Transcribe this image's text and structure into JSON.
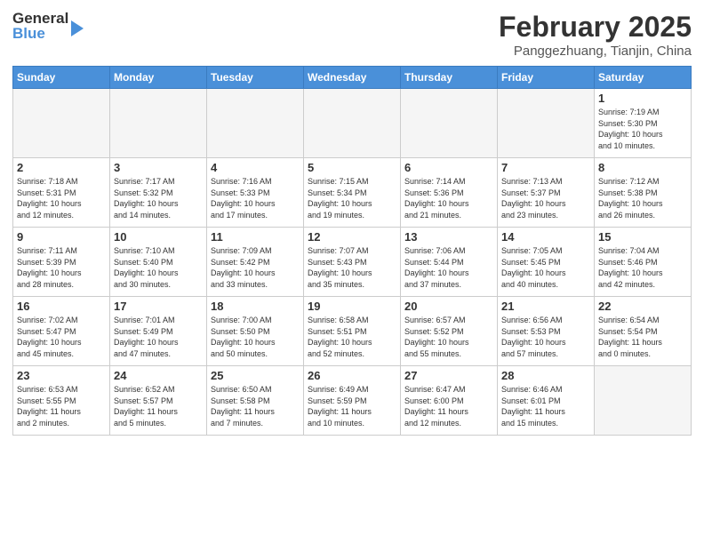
{
  "header": {
    "logo_general": "General",
    "logo_blue": "Blue",
    "month": "February 2025",
    "location": "Panggezhuang, Tianjin, China"
  },
  "weekdays": [
    "Sunday",
    "Monday",
    "Tuesday",
    "Wednesday",
    "Thursday",
    "Friday",
    "Saturday"
  ],
  "weeks": [
    [
      {
        "day": "",
        "info": ""
      },
      {
        "day": "",
        "info": ""
      },
      {
        "day": "",
        "info": ""
      },
      {
        "day": "",
        "info": ""
      },
      {
        "day": "",
        "info": ""
      },
      {
        "day": "",
        "info": ""
      },
      {
        "day": "1",
        "info": "Sunrise: 7:19 AM\nSunset: 5:30 PM\nDaylight: 10 hours\nand 10 minutes."
      }
    ],
    [
      {
        "day": "2",
        "info": "Sunrise: 7:18 AM\nSunset: 5:31 PM\nDaylight: 10 hours\nand 12 minutes."
      },
      {
        "day": "3",
        "info": "Sunrise: 7:17 AM\nSunset: 5:32 PM\nDaylight: 10 hours\nand 14 minutes."
      },
      {
        "day": "4",
        "info": "Sunrise: 7:16 AM\nSunset: 5:33 PM\nDaylight: 10 hours\nand 17 minutes."
      },
      {
        "day": "5",
        "info": "Sunrise: 7:15 AM\nSunset: 5:34 PM\nDaylight: 10 hours\nand 19 minutes."
      },
      {
        "day": "6",
        "info": "Sunrise: 7:14 AM\nSunset: 5:36 PM\nDaylight: 10 hours\nand 21 minutes."
      },
      {
        "day": "7",
        "info": "Sunrise: 7:13 AM\nSunset: 5:37 PM\nDaylight: 10 hours\nand 23 minutes."
      },
      {
        "day": "8",
        "info": "Sunrise: 7:12 AM\nSunset: 5:38 PM\nDaylight: 10 hours\nand 26 minutes."
      }
    ],
    [
      {
        "day": "9",
        "info": "Sunrise: 7:11 AM\nSunset: 5:39 PM\nDaylight: 10 hours\nand 28 minutes."
      },
      {
        "day": "10",
        "info": "Sunrise: 7:10 AM\nSunset: 5:40 PM\nDaylight: 10 hours\nand 30 minutes."
      },
      {
        "day": "11",
        "info": "Sunrise: 7:09 AM\nSunset: 5:42 PM\nDaylight: 10 hours\nand 33 minutes."
      },
      {
        "day": "12",
        "info": "Sunrise: 7:07 AM\nSunset: 5:43 PM\nDaylight: 10 hours\nand 35 minutes."
      },
      {
        "day": "13",
        "info": "Sunrise: 7:06 AM\nSunset: 5:44 PM\nDaylight: 10 hours\nand 37 minutes."
      },
      {
        "day": "14",
        "info": "Sunrise: 7:05 AM\nSunset: 5:45 PM\nDaylight: 10 hours\nand 40 minutes."
      },
      {
        "day": "15",
        "info": "Sunrise: 7:04 AM\nSunset: 5:46 PM\nDaylight: 10 hours\nand 42 minutes."
      }
    ],
    [
      {
        "day": "16",
        "info": "Sunrise: 7:02 AM\nSunset: 5:47 PM\nDaylight: 10 hours\nand 45 minutes."
      },
      {
        "day": "17",
        "info": "Sunrise: 7:01 AM\nSunset: 5:49 PM\nDaylight: 10 hours\nand 47 minutes."
      },
      {
        "day": "18",
        "info": "Sunrise: 7:00 AM\nSunset: 5:50 PM\nDaylight: 10 hours\nand 50 minutes."
      },
      {
        "day": "19",
        "info": "Sunrise: 6:58 AM\nSunset: 5:51 PM\nDaylight: 10 hours\nand 52 minutes."
      },
      {
        "day": "20",
        "info": "Sunrise: 6:57 AM\nSunset: 5:52 PM\nDaylight: 10 hours\nand 55 minutes."
      },
      {
        "day": "21",
        "info": "Sunrise: 6:56 AM\nSunset: 5:53 PM\nDaylight: 10 hours\nand 57 minutes."
      },
      {
        "day": "22",
        "info": "Sunrise: 6:54 AM\nSunset: 5:54 PM\nDaylight: 11 hours\nand 0 minutes."
      }
    ],
    [
      {
        "day": "23",
        "info": "Sunrise: 6:53 AM\nSunset: 5:55 PM\nDaylight: 11 hours\nand 2 minutes."
      },
      {
        "day": "24",
        "info": "Sunrise: 6:52 AM\nSunset: 5:57 PM\nDaylight: 11 hours\nand 5 minutes."
      },
      {
        "day": "25",
        "info": "Sunrise: 6:50 AM\nSunset: 5:58 PM\nDaylight: 11 hours\nand 7 minutes."
      },
      {
        "day": "26",
        "info": "Sunrise: 6:49 AM\nSunset: 5:59 PM\nDaylight: 11 hours\nand 10 minutes."
      },
      {
        "day": "27",
        "info": "Sunrise: 6:47 AM\nSunset: 6:00 PM\nDaylight: 11 hours\nand 12 minutes."
      },
      {
        "day": "28",
        "info": "Sunrise: 6:46 AM\nSunset: 6:01 PM\nDaylight: 11 hours\nand 15 minutes."
      },
      {
        "day": "",
        "info": ""
      }
    ]
  ]
}
